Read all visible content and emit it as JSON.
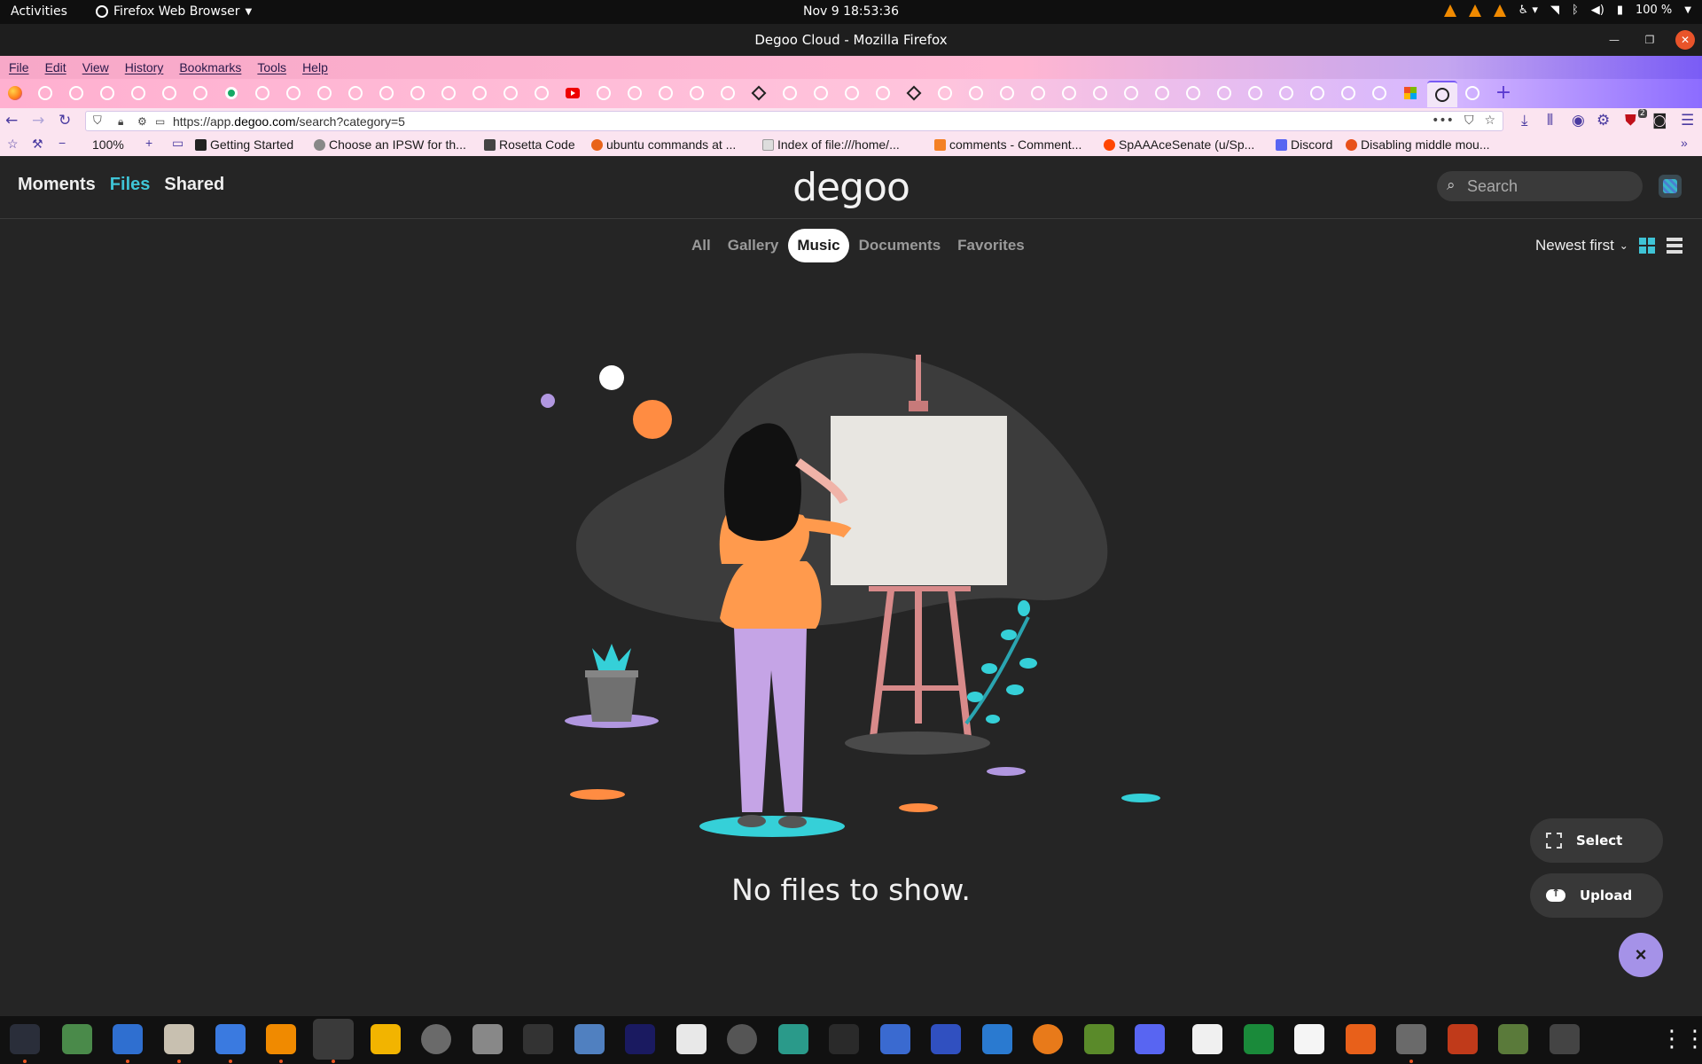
{
  "topbar": {
    "activities": "Activities",
    "app_menu": "Firefox Web Browser",
    "clock": "Nov 9  18:53:36",
    "battery": "100 %"
  },
  "window": {
    "title": "Degoo Cloud - Mozilla Firefox"
  },
  "menubar": [
    "File",
    "Edit",
    "View",
    "History",
    "Bookmarks",
    "Tools",
    "Help"
  ],
  "navbar": {
    "url_prefix": "https://app.",
    "url_domain": "degoo.com",
    "url_path": "/search?category=5",
    "zoom": "100%",
    "downloads_badge": "2"
  },
  "bookmarks": [
    {
      "label": "Getting Started",
      "color": "#222222"
    },
    {
      "label": "Choose an IPSW for th...",
      "color": "#888888"
    },
    {
      "label": "Rosetta Code",
      "color": "#444444"
    },
    {
      "label": "ubuntu commands at ...",
      "color": "#e8631a"
    },
    {
      "label": "Index of file:///home/...",
      "color": "#dddddd"
    },
    {
      "label": "comments - Comment...",
      "color": "#f48024"
    },
    {
      "label": "SpAAAceSenate (u/Sp...",
      "color": "#ff4500"
    },
    {
      "label": "Discord",
      "color": "#5865f2"
    },
    {
      "label": "Disabling middle mou...",
      "color": "#e8501a"
    }
  ],
  "app": {
    "nav": [
      "Moments",
      "Files",
      "Shared"
    ],
    "nav_active": "Files",
    "logo": "degoo",
    "search_placeholder": "Search",
    "categories": [
      "All",
      "Gallery",
      "Music",
      "Documents",
      "Favorites"
    ],
    "category_active": "Music",
    "sort": "Newest first",
    "empty_message": "No files to show.",
    "fab_select": "Select",
    "fab_upload": "Upload",
    "fab_close": "×"
  },
  "colors": {
    "accent": "#3fc4d6",
    "fab_close": "#a592e8",
    "background": "#252525"
  }
}
